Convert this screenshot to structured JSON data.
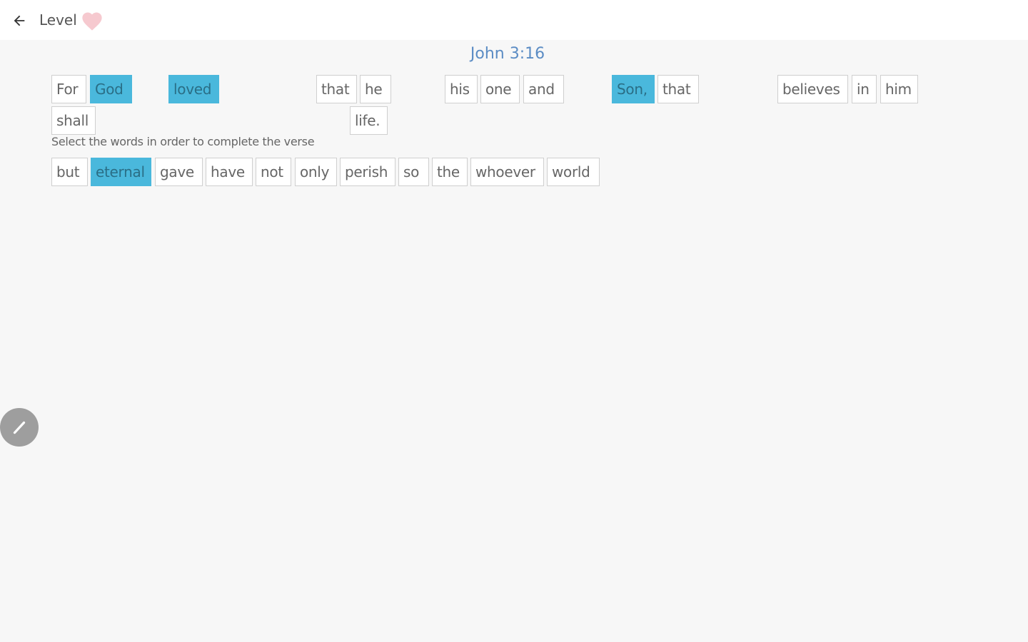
{
  "header": {
    "back_icon": "arrow-left-icon",
    "title": "Level",
    "heart_icon": "heart-icon",
    "heart_color": "#f6c9cf"
  },
  "verse": {
    "reference": "John 3:16",
    "reference_color": "#5b8cc4",
    "placed_words": [
      "For",
      "God",
      "loved",
      "that",
      "he",
      "his",
      "one",
      "and",
      "Son,",
      "that",
      "believes",
      "in",
      "him",
      "shall",
      "life."
    ],
    "highlighted_words": [
      "God",
      "loved",
      "Son,"
    ]
  },
  "instruction": "Select the words in order to complete the verse",
  "word_bank": [
    "but",
    "eternal",
    "gave",
    "have",
    "not",
    "only",
    "perish",
    "so",
    "the",
    "whoever",
    "world"
  ],
  "word_bank_highlighted": [
    "eternal"
  ],
  "highlight_color": "#4ab8dc",
  "fab_icon": "pencil-icon"
}
